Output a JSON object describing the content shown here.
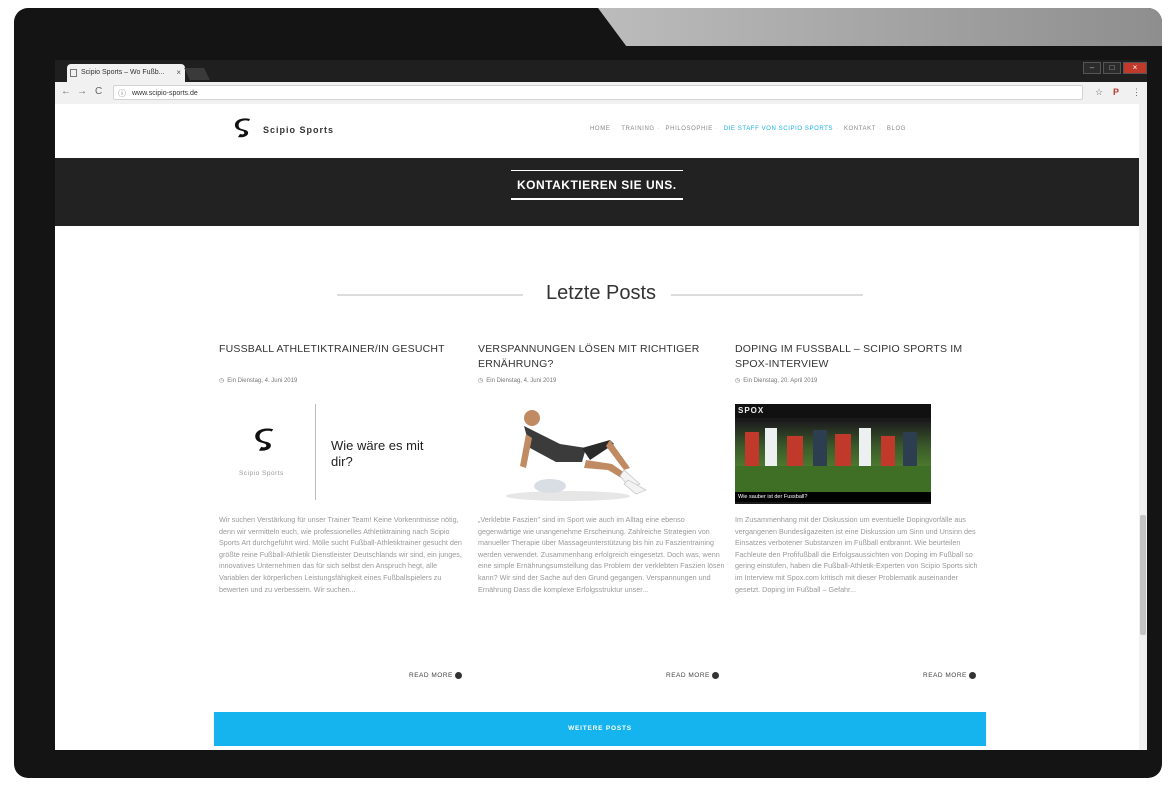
{
  "browser": {
    "tab_title": "Scipio Sports – Wo Fußb...",
    "tab_close": "×",
    "url": "www.scipio-sports.de",
    "back": "←",
    "forward": "→",
    "reload": "C",
    "info_icon": "ⓘ",
    "ext_star": "☆",
    "ext_pdf": "P",
    "menu_dots": "⋮",
    "win_min": "–",
    "win_max": "□",
    "win_close": "×"
  },
  "site": {
    "brand": "Scipio Sports",
    "nav": [
      "HOME",
      "TRAINING",
      "PHILOSOPHIE",
      "DIE STAFF VON SCIPIO SPORTS",
      "KONTAKT",
      "BLOG"
    ],
    "nav_active_index": 3,
    "nav_separator": "·",
    "accent": "#1ab0e8"
  },
  "banner": {
    "cta": "KONTAKTIEREN SIE UNS."
  },
  "section": {
    "title": "Letzte Posts"
  },
  "posts": [
    {
      "title": "FUSSBALL ATHLETIKTRAINER/IN GESUCHT",
      "meta": "Ein Dienstag, 4. Juni 2019",
      "image_kind": "hiring-card",
      "image_brand": "Scipio Sports",
      "image_slogan": "Wie wäre es mit dir?",
      "excerpt": "Wir suchen Verstärkung für unser Trainer Team! Keine Vorkenntnisse nötig, denn wir vermitteln euch, wie professionelles Athletiktraining nach Scipio Sports Art durchgeführt wird. Mölle sucht Fußball-Athletiktrainer gesucht den größte reine Fußball-Athletik Dienstleister Deutschlands wir sind, ein junges, innovatives Unternehmen das für sich selbst den Anspruch hegt, alle Variablen der körperlichen Leistungsfähigkeit eines Fußballspielers zu bewerten und zu verbessern. Wir suchen...",
      "read_more": "READ MORE"
    },
    {
      "title": "VERSPANNUNGEN LÖSEN MIT RICHTIGER ERNÄHRUNG?",
      "meta": "Ein Dienstag, 4. Juni 2019",
      "image_kind": "athlete",
      "excerpt": "„Verklebte Faszien\" sind im Sport wie auch im Alltag eine ebenso gegenwärtige wie unangenehme Erscheinung. Zahlreiche Strategien von manueller Therapie über Massageunterstützung bis hin zu Faszientraining werden verwendet. Zusammenhang erfolgreich eingesetzt. Doch was, wenn eine simple Ernährungsumstellung das Problem der verklebten Faszien lösen kann? Wir sind der Sache auf den Grund gegangen. Verspannungen und Ernährung Dass die komplexe Erfolgsstruktur unser...",
      "read_more": "READ MORE"
    },
    {
      "title": "DOPING IM FUSSBALL – SCIPIO SPORTS IM SPOX-INTERVIEW",
      "meta": "Ein Dienstag, 20. April 2019",
      "image_kind": "spox-screenshot",
      "image_logo": "SPOX",
      "image_caption": "Wie sauber ist der Fussball?",
      "excerpt": "Im Zusammenhang mit der Diskussion um eventuelle Dopingvorfälle aus vergangenen Bundesligazeiten ist eine Diskussion um Sinn und Unsinn des Einsatzes verbotener Substanzen im Fußball entbrannt. Wie beurteilen Fachleute den Profifußball die Erfolgsaussichten von Doping im Fußball so gering einstufen, haben die Fußball-Athletik-Experten von Scipio Sports sich im Interview mit Spox.com kritisch mit dieser Problematik auseinander gesetzt. Doping im Fußball – Gefahr...",
      "read_more": "READ MORE"
    }
  ],
  "more_posts": "WEITERE POSTS"
}
